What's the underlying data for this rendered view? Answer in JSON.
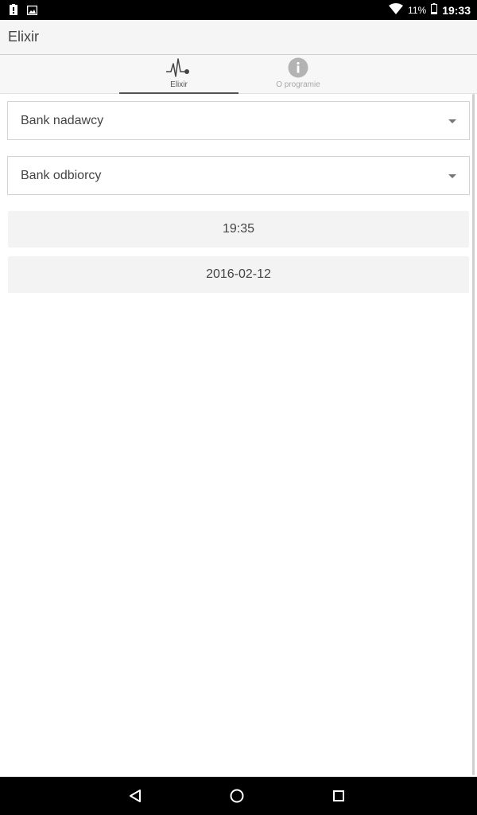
{
  "status_bar": {
    "battery_percent": "11%",
    "time": "19:33",
    "icons": [
      "alert-icon",
      "image-icon",
      "wifi-icon"
    ]
  },
  "app_bar": {
    "title": "Elixir"
  },
  "tabs": [
    {
      "label": "Elixir",
      "icon": "heartbeat-icon",
      "selected": true
    },
    {
      "label": "O programie",
      "icon": "info-icon",
      "selected": false
    }
  ],
  "form": {
    "sender_bank_label": "Bank nadawcy",
    "receiver_bank_label": "Bank odbiorcy",
    "time_value": "19:35",
    "date_value": "2016-02-12"
  },
  "nav_bar": {
    "icons": [
      "back-icon",
      "home-icon",
      "recent-apps-icon"
    ]
  }
}
